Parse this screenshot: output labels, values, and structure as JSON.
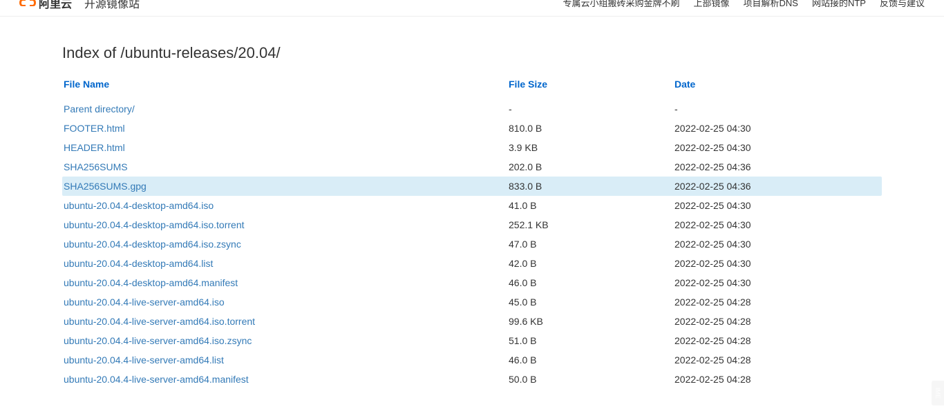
{
  "header": {
    "logo_text": "阿里云",
    "site_title": "开源镜像站",
    "nav": [
      "专属云小组搬砖采购金牌不刷",
      "上部镜像",
      "项目解析DNS",
      "网站接的NTP",
      "反馈与建议"
    ]
  },
  "page": {
    "title": "Index of /ubuntu-releases/20.04/"
  },
  "table": {
    "headers": {
      "name": "File Name",
      "size": "File Size",
      "date": "Date"
    },
    "rows": [
      {
        "name": "Parent directory/",
        "size": "-",
        "date": "-",
        "highlighted": false
      },
      {
        "name": "FOOTER.html",
        "size": "810.0 B",
        "date": "2022-02-25 04:30",
        "highlighted": false
      },
      {
        "name": "HEADER.html",
        "size": "3.9 KB",
        "date": "2022-02-25 04:30",
        "highlighted": false
      },
      {
        "name": "SHA256SUMS",
        "size": "202.0 B",
        "date": "2022-02-25 04:36",
        "highlighted": false
      },
      {
        "name": "SHA256SUMS.gpg",
        "size": "833.0 B",
        "date": "2022-02-25 04:36",
        "highlighted": true
      },
      {
        "name": "ubuntu-20.04.4-desktop-amd64.iso",
        "size": "41.0 B",
        "date": "2022-02-25 04:30",
        "highlighted": false
      },
      {
        "name": "ubuntu-20.04.4-desktop-amd64.iso.torrent",
        "size": "252.1 KB",
        "date": "2022-02-25 04:30",
        "highlighted": false
      },
      {
        "name": "ubuntu-20.04.4-desktop-amd64.iso.zsync",
        "size": "47.0 B",
        "date": "2022-02-25 04:30",
        "highlighted": false
      },
      {
        "name": "ubuntu-20.04.4-desktop-amd64.list",
        "size": "42.0 B",
        "date": "2022-02-25 04:30",
        "highlighted": false
      },
      {
        "name": "ubuntu-20.04.4-desktop-amd64.manifest",
        "size": "46.0 B",
        "date": "2022-02-25 04:30",
        "highlighted": false
      },
      {
        "name": "ubuntu-20.04.4-live-server-amd64.iso",
        "size": "45.0 B",
        "date": "2022-02-25 04:28",
        "highlighted": false
      },
      {
        "name": "ubuntu-20.04.4-live-server-amd64.iso.torrent",
        "size": "99.6 KB",
        "date": "2022-02-25 04:28",
        "highlighted": false
      },
      {
        "name": "ubuntu-20.04.4-live-server-amd64.iso.zsync",
        "size": "51.0 B",
        "date": "2022-02-25 04:28",
        "highlighted": false
      },
      {
        "name": "ubuntu-20.04.4-live-server-amd64.list",
        "size": "46.0 B",
        "date": "2022-02-25 04:28",
        "highlighted": false
      },
      {
        "name": "ubuntu-20.04.4-live-server-amd64.manifest",
        "size": "50.0 B",
        "date": "2022-02-25 04:28",
        "highlighted": false
      }
    ]
  },
  "side_tab": "IME"
}
